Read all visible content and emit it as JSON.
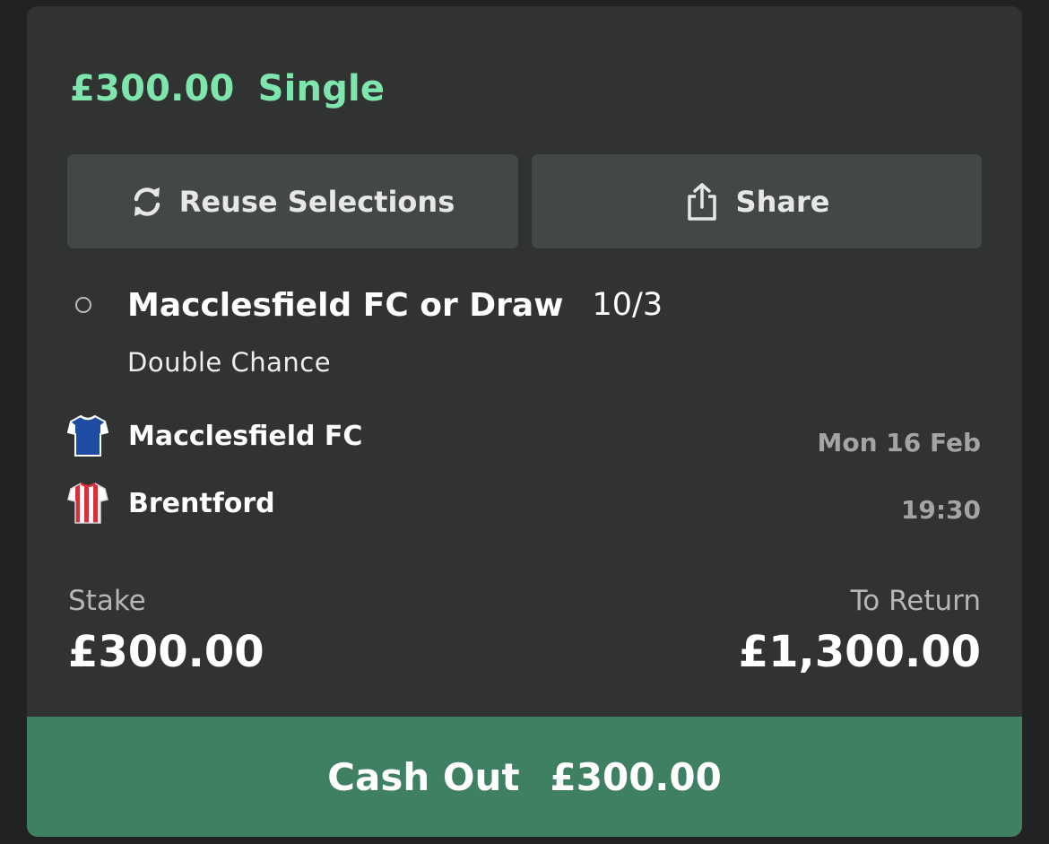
{
  "bet": {
    "amount": "£300.00",
    "type": "Single"
  },
  "actions": {
    "reuse_label": "Reuse Selections",
    "share_label": "Share",
    "reuse_icon": "refresh-icon",
    "share_icon": "share-icon"
  },
  "selection": {
    "name": "Macclesfield FC or Draw",
    "odds": "10/3",
    "market": "Double Chance",
    "status": "open"
  },
  "match": {
    "home": {
      "name": "Macclesfield FC",
      "kit_icon": "kit-blue-white-icon",
      "kit_colors": [
        "#1f4da3",
        "#ffffff"
      ]
    },
    "away": {
      "name": "Brentford",
      "kit_icon": "kit-red-white-stripes-icon",
      "kit_colors": [
        "#d6303b",
        "#ffffff"
      ]
    },
    "date": "Mon 16 Feb",
    "time": "19:30"
  },
  "totals": {
    "stake_label": "Stake",
    "stake_value": "£300.00",
    "return_label": "To Return",
    "return_value": "£1,300.00"
  },
  "cashout": {
    "label": "Cash Out",
    "amount": "£300.00"
  },
  "colors": {
    "accent_green": "#7ee5ad",
    "cashout_green": "#3e8061",
    "card_bg": "#303331",
    "button_bg": "#434846"
  }
}
